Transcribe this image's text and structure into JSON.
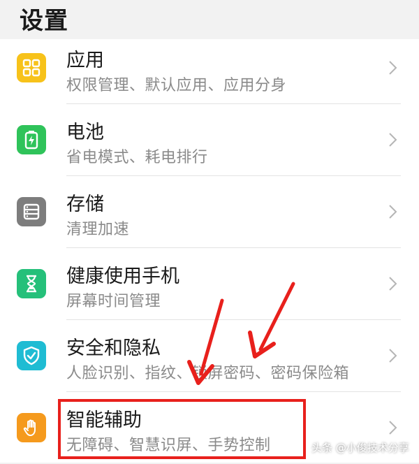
{
  "header": {
    "title": "设置"
  },
  "items": [
    {
      "label": "应用",
      "sub": "权限管理、默认应用、应用分身",
      "icon": "apps-grid-icon",
      "color": "#f7c21a"
    },
    {
      "label": "电池",
      "sub": "省电模式、耗电排行",
      "icon": "battery-icon",
      "color": "#2fc35a"
    },
    {
      "label": "存储",
      "sub": "清理加速",
      "icon": "storage-icon",
      "color": "#7d7d7d"
    },
    {
      "label": "健康使用手机",
      "sub": "屏幕时间管理",
      "icon": "hourglass-icon",
      "color": "#25c07a"
    },
    {
      "label": "安全和隐私",
      "sub": "人脸识别、指纹、锁屏密码、密码保险箱",
      "icon": "shield-icon",
      "color": "#1fbcd3"
    },
    {
      "label": "智能辅助",
      "sub": "无障碍、智慧识屏、手势控制",
      "icon": "hand-icon",
      "color": "#f59a1d"
    }
  ],
  "annotation": {
    "highlight_color": "#e8201c",
    "arrow_color": "#e8201c"
  },
  "watermark": "头条 @小俊技术分享"
}
